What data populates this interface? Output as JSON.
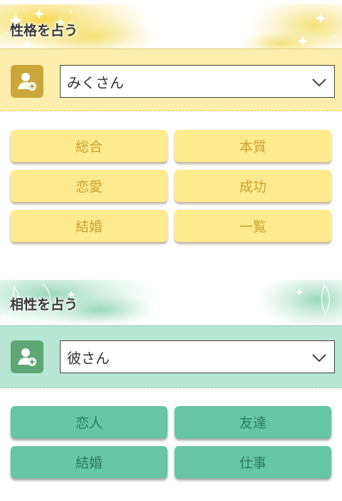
{
  "personality": {
    "title": "性格を占う",
    "selected_person": "みくさん",
    "buttons": [
      "総合",
      "本質",
      "恋愛",
      "成功",
      "結婚",
      "一覧"
    ]
  },
  "compatibility": {
    "title": "相性を占う",
    "selected_person": "彼さん",
    "buttons": [
      "恋人",
      "友達",
      "結婚",
      "仕事"
    ]
  },
  "colors": {
    "yellow_button": "#feeb8d",
    "yellow_text": "#c7a230",
    "green_button": "#66c6a6",
    "green_text": "#2f7a60"
  }
}
